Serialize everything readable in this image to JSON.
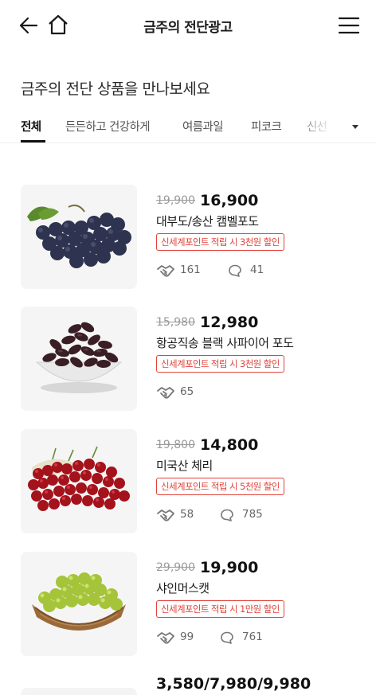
{
  "header": {
    "title": "금주의 전단광고",
    "back_icon": "arrow-left-icon",
    "home_icon": "home-icon",
    "menu_icon": "hamburger-menu-icon"
  },
  "section": {
    "title": "금주의 전단 상품을 만나보세요"
  },
  "tabs": [
    {
      "label": "전체",
      "active": true
    },
    {
      "label": "든든하고 건강하게",
      "active": false
    },
    {
      "label": "여름과일",
      "active": false
    },
    {
      "label": "피코크",
      "active": false
    },
    {
      "label": "신선",
      "active": false
    }
  ],
  "tab_dropdown_icon": "caret-down-icon",
  "colors": {
    "promo_red": "#e0433a",
    "text_dark": "#111111",
    "muted": "#9a9a9a"
  },
  "products": [
    {
      "original_price": "19,900",
      "price": "16,900",
      "name": "대부도/송산 캠벨포도",
      "promo": "신세계포인트 적립 시 3천원 할인",
      "likes": "161",
      "comments": "41",
      "image": "grapes-campbell"
    },
    {
      "original_price": "15,980",
      "price": "12,980",
      "name": "항공직송 블랙 사파이어 포도",
      "promo": "신세계포인트 적립 시 3천원 할인",
      "likes": "65",
      "comments": null,
      "image": "black-sapphire-grapes"
    },
    {
      "original_price": "19,800",
      "price": "14,800",
      "name": "미국산 체리",
      "promo": "신세계포인트 적립 시 5천원 할인",
      "likes": "58",
      "comments": "785",
      "image": "cherries"
    },
    {
      "original_price": "29,900",
      "price": "19,900",
      "name": "샤인머스캣",
      "promo": "신세계포인트 적립 시 1만원 할인",
      "likes": "99",
      "comments": "761",
      "image": "shine-muscat"
    },
    {
      "price": "3,580/7,980/9,980"
    }
  ]
}
